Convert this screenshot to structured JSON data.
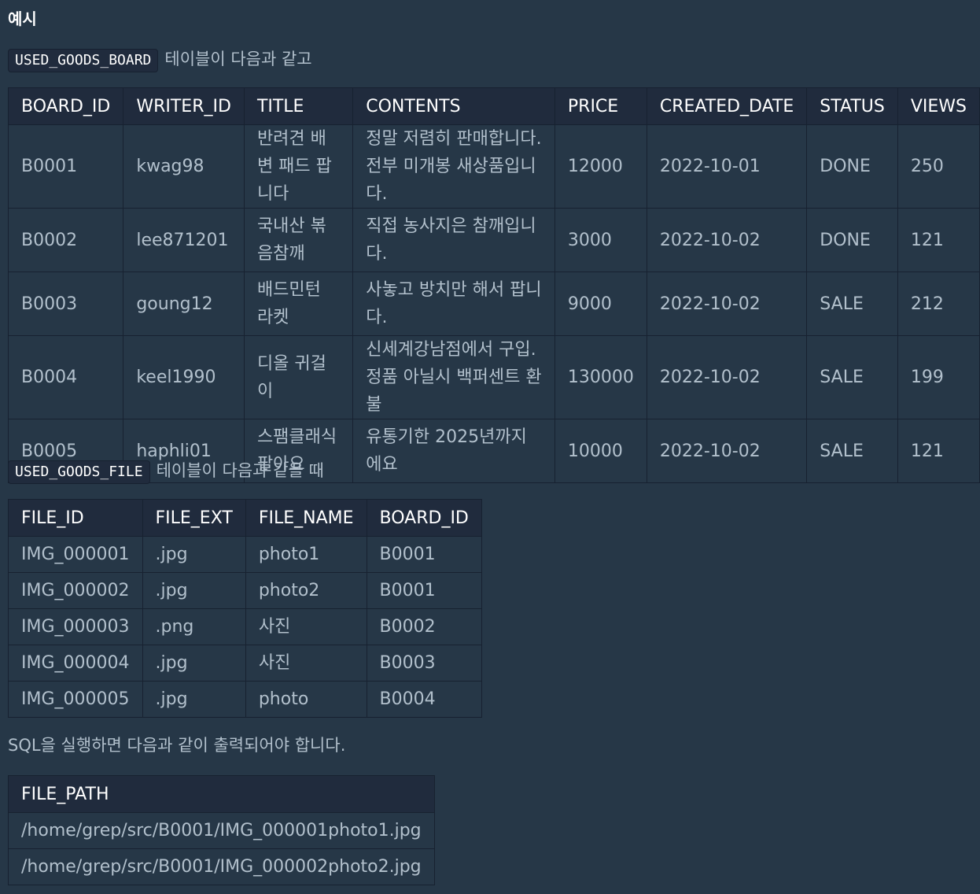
{
  "heading": "예시",
  "board_intro": {
    "code": "USED_GOODS_BOARD",
    "text": "테이블이 다음과 같고"
  },
  "board_table": {
    "columns": [
      "BOARD_ID",
      "WRITER_ID",
      "TITLE",
      "CONTENTS",
      "PRICE",
      "CREATED_DATE",
      "STATUS",
      "VIEWS"
    ],
    "rows": [
      [
        "B0001",
        "kwag98",
        "반려견 배변 패드 팝니다",
        "정말 저렴히 판매합니다. 전부 미개봉 새상품입니다.",
        "12000",
        "2022-10-01",
        "DONE",
        "250"
      ],
      [
        "B0002",
        "lee871201",
        "국내산 볶음참깨",
        "직접 농사지은 참깨입니다.",
        "3000",
        "2022-10-02",
        "DONE",
        "121"
      ],
      [
        "B0003",
        "goung12",
        "배드민턴 라켓",
        "사놓고 방치만 해서 팝니다.",
        "9000",
        "2022-10-02",
        "SALE",
        "212"
      ],
      [
        "B0004",
        "keel1990",
        "디올 귀걸이",
        "신세계강남점에서 구입. 정품 아닐시 백퍼센트 환불",
        "130000",
        "2022-10-02",
        "SALE",
        "199"
      ],
      [
        "B0005",
        "haphli01",
        "스팸클래식 팔아요",
        "유통기한 2025년까지에요",
        "10000",
        "2022-10-02",
        "SALE",
        "121"
      ]
    ]
  },
  "file_intro": {
    "code": "USED_GOODS_FILE",
    "text": "테이블이 다음과 같을 때"
  },
  "file_table": {
    "columns": [
      "FILE_ID",
      "FILE_EXT",
      "FILE_NAME",
      "BOARD_ID"
    ],
    "rows": [
      [
        "IMG_000001",
        ".jpg",
        "photo1",
        "B0001"
      ],
      [
        "IMG_000002",
        ".jpg",
        "photo2",
        "B0001"
      ],
      [
        "IMG_000003",
        ".png",
        "사진",
        "B0002"
      ],
      [
        "IMG_000004",
        ".jpg",
        "사진",
        "B0003"
      ],
      [
        "IMG_000005",
        ".jpg",
        "photo",
        "B0004"
      ]
    ]
  },
  "result_intro": "SQL을 실행하면 다음과 같이 출력되어야 합니다.",
  "result_table": {
    "columns": [
      "FILE_PATH"
    ],
    "rows": [
      [
        "/home/grep/src/B0001/IMG_000001photo1.jpg"
      ],
      [
        "/home/grep/src/B0001/IMG_000002photo2.jpg"
      ]
    ]
  }
}
